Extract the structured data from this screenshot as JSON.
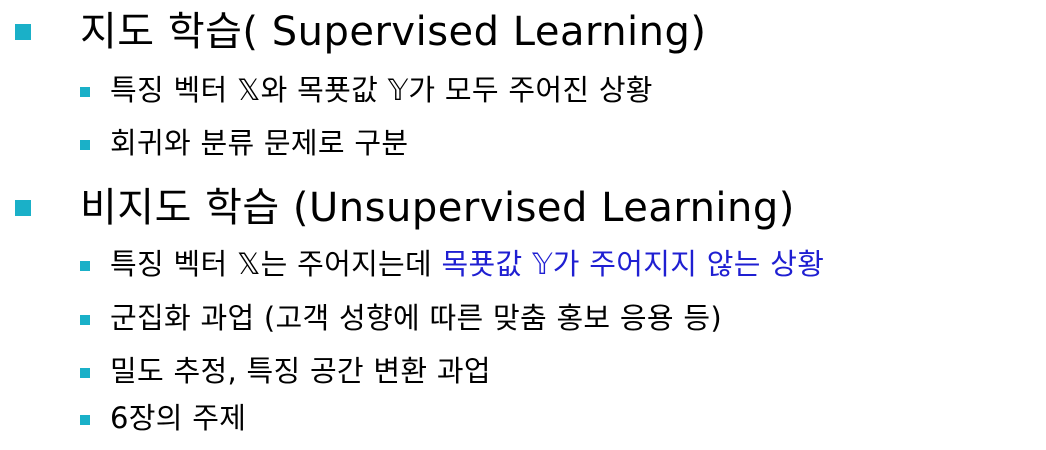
{
  "accent_color": "#1ab0c8",
  "highlight_color": "#1f1fd2",
  "sections": [
    {
      "heading": "지도 학습( Supervised Learning)",
      "items": [
        "특징 벡터 𝕏와 목푯값 𝕐가 모두 주어진 상황",
        "회귀와 분류 문제로 구분"
      ]
    },
    {
      "heading": "비지도 학습 (Unsupervised Learning)",
      "items": [
        {
          "plain": "특징 벡터 𝕏는 주어지는데 ",
          "highlight": "목푯값 𝕐가 주어지지 않는 상황"
        },
        "군집화 과업 (고객 성향에 따른 맞춤 홍보 응용 등)",
        "밀도 추정, 특징 공간 변환 과업",
        "6장의 주제"
      ]
    }
  ]
}
